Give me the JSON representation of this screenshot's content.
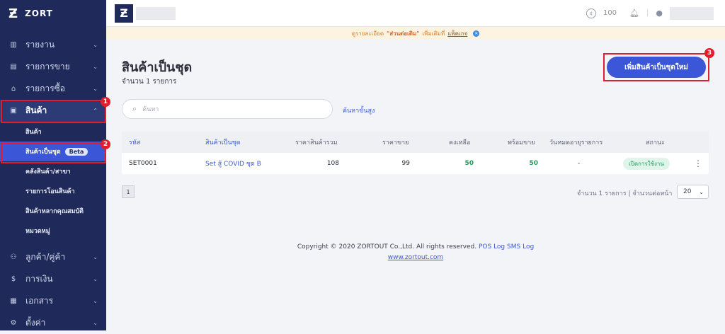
{
  "sidebar": {
    "logo": "ZORT",
    "items": [
      {
        "label": "รายงาน",
        "icon": "chart-icon"
      },
      {
        "label": "รายการขาย",
        "icon": "clipboard-icon"
      },
      {
        "label": "รายการซื้อ",
        "icon": "basket-icon"
      },
      {
        "label": "สินค้า",
        "icon": "box-icon"
      }
    ],
    "sub_items": [
      {
        "label": "สินค้า"
      },
      {
        "label": "สินค้าเป็นชุด",
        "badge": "Beta"
      },
      {
        "label": "คลังสินค้า/สาขา"
      },
      {
        "label": "รายการโอนสินค้า"
      },
      {
        "label": "สินค้าหลากคุณสมบัติ"
      },
      {
        "label": "หมวดหมู่"
      }
    ],
    "bottom_items": [
      {
        "label": "ลูกค้า/คู่ค้า",
        "icon": "users-icon"
      },
      {
        "label": "การเงิน",
        "icon": "money-icon"
      },
      {
        "label": "เอกสาร",
        "icon": "document-icon"
      },
      {
        "label": "ตั้งค่า",
        "icon": "gear-icon"
      }
    ]
  },
  "annotations": [
    "1",
    "2",
    "3"
  ],
  "topbar": {
    "coins": "100"
  },
  "notice": {
    "prefix": "ดูรายละเอียด",
    "bold": "\"ส่วนต่อเติม\"",
    "middle": "เพิ่มเติมที่",
    "link": "แพ็คเกจ"
  },
  "page": {
    "title": "สินค้าเป็นชุด",
    "count": "จำนวน 1 รายการ",
    "add_button": "เพิ่มสินค้าเป็นชุดใหม่",
    "search_placeholder": "ค้นหา",
    "advanced_search": "ค้นหาขั้นสูง"
  },
  "table": {
    "headers": [
      "รหัส",
      "สินค้าเป็นชุด",
      "ราคาสินค้ารวม",
      "ราคาขาย",
      "คงเหลือ",
      "พร้อมขาย",
      "วันหมดอายุรายการ",
      "สถานะ"
    ],
    "rows": [
      {
        "code": "SET0001",
        "name": "Set สู้ COVID ชุด B",
        "total": "108",
        "price": "99",
        "stock": "50",
        "ready": "50",
        "expire": "-",
        "status": "เปิดการใช้งาน"
      }
    ]
  },
  "pagination": {
    "page": "1",
    "summary": "จำนวน 1 รายการ | จำนวนต่อหน้า",
    "per_page": "20"
  },
  "footer": {
    "copyright": "Copyright © 2020 ZORTOUT Co.,Ltd. All rights reserved.",
    "pos_log": "POS Log",
    "sms_log": "SMS Log",
    "website": "www.zortout.com"
  }
}
